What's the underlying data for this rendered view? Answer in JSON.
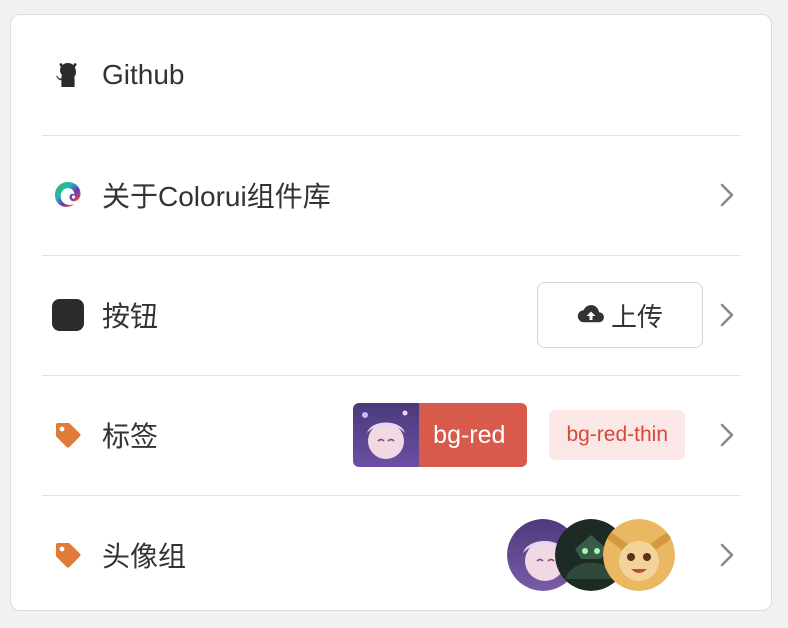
{
  "rows": [
    {
      "label": "Github",
      "icon": "github-icon"
    },
    {
      "label": "关于Colorui组件库",
      "icon": "colorui-logo-icon"
    },
    {
      "label": "按钮",
      "icon": "rounded-square-icon",
      "button_label": "上传",
      "button_icon": "cloud-upload-icon"
    },
    {
      "label": "标签",
      "icon": "tag-icon",
      "tag_red_label": "bg-red",
      "tag_thin_label": "bg-red-thin"
    },
    {
      "label": "头像组",
      "icon": "tag-icon",
      "avatar_count": 3
    }
  ],
  "colors": {
    "accent_red": "#d85a4b",
    "thin_red_bg": "#fbe8e6",
    "tag_icon": "#e07b39"
  }
}
